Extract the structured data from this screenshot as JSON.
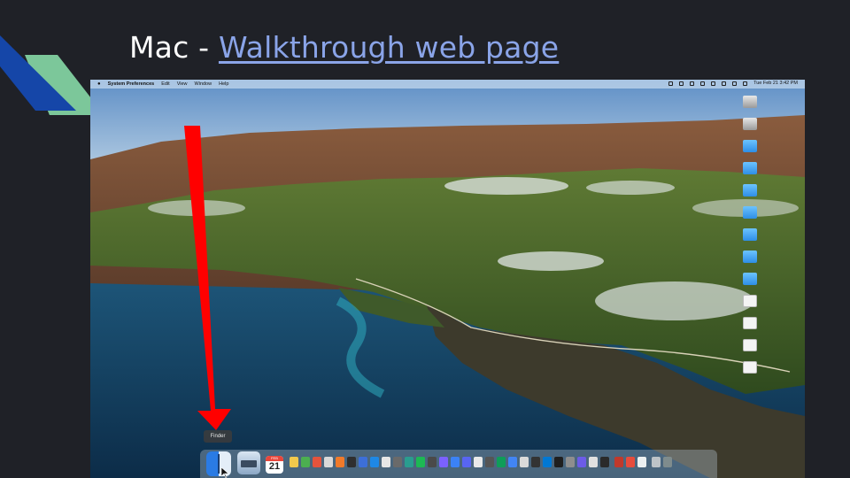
{
  "slide": {
    "title_prefix": "Mac - ",
    "title_link": "Walkthrough web page",
    "accent_link_color": "#8aa4e8"
  },
  "screenshot": {
    "menubar": {
      "app_name": "System Preferences",
      "menus": [
        "Edit",
        "View",
        "Window",
        "Help"
      ],
      "clock": "Tue Feb 21  3:42 PM"
    },
    "tooltip": "Finder",
    "calendar": {
      "month": "FEB",
      "day": "21"
    },
    "arrow_color": "#ff0000"
  }
}
